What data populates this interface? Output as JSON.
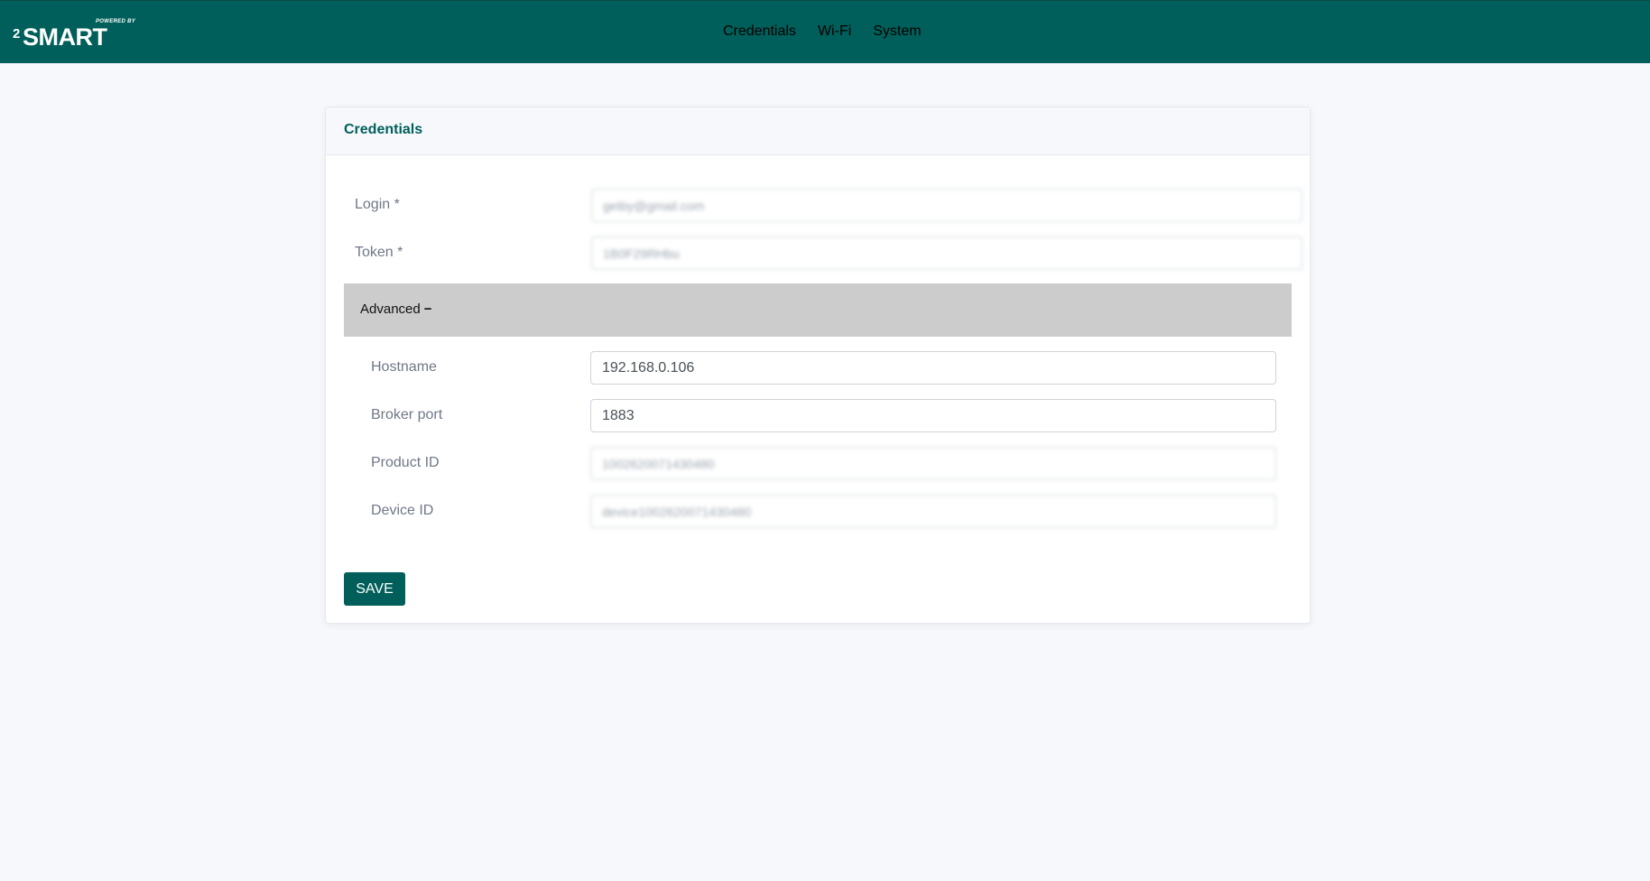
{
  "brand": {
    "powered_by": "POWERED BY",
    "superscript": "2",
    "name": "SMART"
  },
  "nav": {
    "items": [
      {
        "label": "Credentials",
        "active": true
      },
      {
        "label": "Wi-Fi",
        "active": false
      },
      {
        "label": "System",
        "active": false
      }
    ]
  },
  "card": {
    "title": "Credentials",
    "fields": {
      "login": {
        "label": "Login *",
        "value": "getby@gmail.com"
      },
      "token": {
        "label": "Token *",
        "value": "1B0F29RHbu"
      }
    },
    "advanced": {
      "label": "Advanced",
      "toggle": "−",
      "fields": {
        "hostname": {
          "label": "Hostname",
          "value": "192.168.0.106"
        },
        "broker_port": {
          "label": "Broker port",
          "value": "1883"
        },
        "product_id": {
          "label": "Product ID",
          "value": "1002620071430480"
        },
        "device_id": {
          "label": "Device ID",
          "value": "device1002620071430480"
        }
      }
    },
    "save_label": "SAVE"
  },
  "colors": {
    "brand": "#005f5a",
    "background": "#f7f8fc",
    "advanced_bar": "#cccccc"
  }
}
